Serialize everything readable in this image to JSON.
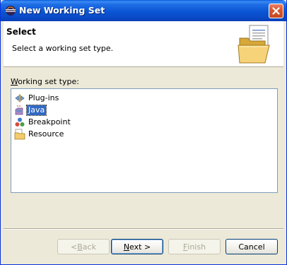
{
  "window": {
    "title": "New Working Set",
    "icons": {
      "app": "eclipse-icon",
      "close": "close-icon"
    }
  },
  "header": {
    "title": "Select",
    "description": "Select a working set type.",
    "image": "open-folder-document-icon"
  },
  "list": {
    "label_mnemonic": "W",
    "label_rest": "orking set type:",
    "items": [
      {
        "label": "Plug-ins",
        "icon": "plugin-icon",
        "selected": false
      },
      {
        "label": "Java",
        "icon": "java-icon",
        "selected": true
      },
      {
        "label": "Breakpoint",
        "icon": "breakpoint-icon",
        "selected": false
      },
      {
        "label": "Resource",
        "icon": "resource-folder-icon",
        "selected": false
      }
    ]
  },
  "buttons": {
    "back": {
      "prefix": "< ",
      "mnemonic": "B",
      "rest": "ack",
      "enabled": false
    },
    "next": {
      "mnemonic": "N",
      "rest": "ext >",
      "enabled": true
    },
    "finish": {
      "mnemonic": "F",
      "rest": "inish",
      "enabled": false
    },
    "cancel": {
      "label": "Cancel",
      "enabled": true
    }
  },
  "colors": {
    "selection": "#316AC5",
    "titlebar": "#0A55D4",
    "dialog_bg": "#ECE9D8"
  }
}
